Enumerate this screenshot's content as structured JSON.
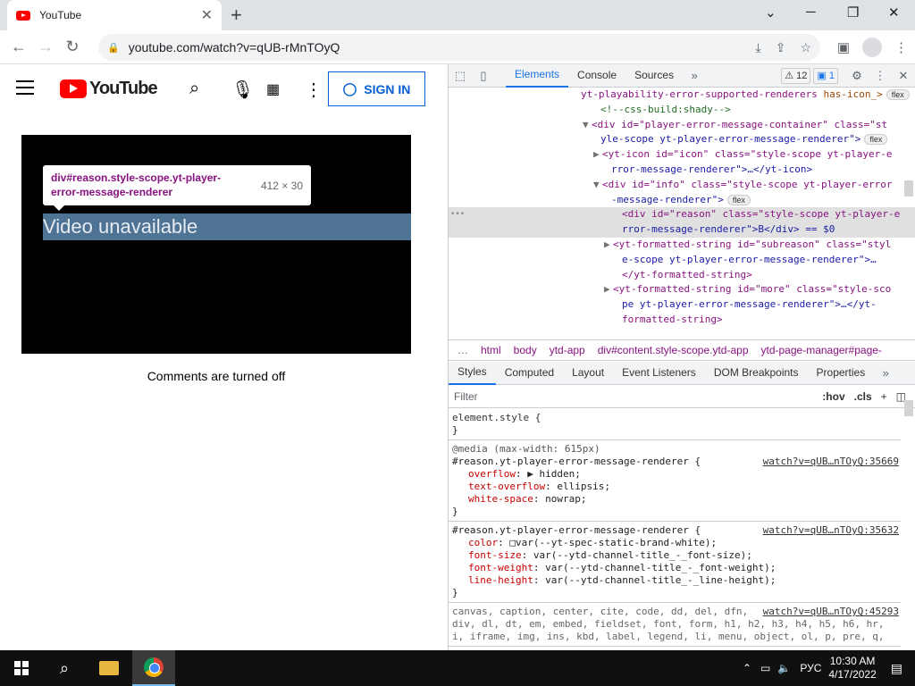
{
  "browser": {
    "tab_title": "YouTube",
    "url": "youtube.com/watch?v=qUB-rMnTOyQ"
  },
  "youtube": {
    "logo_text": "YouTube",
    "signin_label": "SIGN IN",
    "tooltip_name": "div#reason.style-scope.yt-player-error-message-renderer",
    "tooltip_size": "412 × 30",
    "reason_text": "Video unavailable",
    "comments_text": "Comments are turned off"
  },
  "devtools": {
    "tabs": [
      "Elements",
      "Console",
      "Sources"
    ],
    "warn_count": "12",
    "info_count": "1",
    "dom_lines": [
      {
        "indent": 148,
        "tri": "",
        "html": "yt-playability-error-supported-renderers",
        "type": "tg",
        "extra": " has-icon_>",
        "flex": true
      },
      {
        "indent": 170,
        "tri": "",
        "html": "<!--css-build:shady-->",
        "type": "cm"
      },
      {
        "indent": 160,
        "tri": "▼",
        "html": "<div id=\"player-error-message-container\" class=\"st",
        "type": "mix"
      },
      {
        "indent": 170,
        "tri": "",
        "html": "yle-scope yt-player-error-message-renderer\">",
        "type": "av",
        "flex": true
      },
      {
        "indent": 172,
        "tri": "▶",
        "html": "<yt-icon id=\"icon\" class=\"style-scope yt-player-e",
        "type": "mix"
      },
      {
        "indent": 182,
        "tri": "",
        "html": "rror-message-renderer\">…</yt-icon>",
        "type": "av"
      },
      {
        "indent": 172,
        "tri": "▼",
        "html": "<div id=\"info\" class=\"style-scope yt-player-error",
        "type": "mix"
      },
      {
        "indent": 182,
        "tri": "",
        "html": "-message-renderer\">",
        "type": "av",
        "flex": true
      },
      {
        "indent": 194,
        "tri": "",
        "html": "<div id=\"reason\" class=\"style-scope yt-player-e",
        "type": "mix",
        "sel": true
      },
      {
        "indent": 194,
        "tri": "",
        "html": "rror-message-renderer\">B</div> == $0",
        "type": "av",
        "sel": true
      },
      {
        "indent": 184,
        "tri": "▶",
        "html": "<yt-formatted-string id=\"subreason\" class=\"styl",
        "type": "mix"
      },
      {
        "indent": 194,
        "tri": "",
        "html": "e-scope yt-player-error-message-renderer\">…",
        "type": "av"
      },
      {
        "indent": 194,
        "tri": "",
        "html": "</yt-formatted-string>",
        "type": "tg"
      },
      {
        "indent": 184,
        "tri": "▶",
        "html": "<yt-formatted-string id=\"more\" class=\"style-sco",
        "type": "mix"
      },
      {
        "indent": 194,
        "tri": "",
        "html": "pe yt-player-error-message-renderer\">…</yt-",
        "type": "av"
      },
      {
        "indent": 194,
        "tri": "",
        "html": "formatted-string>",
        "type": "tg"
      }
    ],
    "breadcrumbs": [
      "…",
      "html",
      "body",
      "ytd-app",
      "div#content.style-scope.ytd-app",
      "ytd-page-manager#page-"
    ],
    "sub_tabs": [
      "Styles",
      "Computed",
      "Layout",
      "Event Listeners",
      "DOM Breakpoints",
      "Properties"
    ],
    "filter_placeholder": "Filter",
    "hov": ":hov",
    "cls": ".cls",
    "element_style": "element.style {",
    "rule1": {
      "media": "@media (max-width: 615px)",
      "selector": "#reason.yt-player-error-message-renderer {",
      "source": "watch?v=qUB…nTOyQ:35669",
      "props": [
        {
          "name": "overflow",
          "value": "▶ hidden;"
        },
        {
          "name": "text-overflow",
          "value": "ellipsis;"
        },
        {
          "name": "white-space",
          "value": "nowrap;"
        }
      ]
    },
    "rule2": {
      "selector": "#reason.yt-player-error-message-renderer {",
      "source": "watch?v=qUB…nTOyQ:35632",
      "props": [
        {
          "name": "color",
          "value": "□var(--yt-spec-static-brand-white);"
        },
        {
          "name": "font-size",
          "value": "var(--ytd-channel-title_-_font-size);"
        },
        {
          "name": "font-weight",
          "value": "var(--ytd-channel-title_-_font-weight);"
        },
        {
          "name": "line-height",
          "value": "var(--ytd-channel-title_-_line-height);"
        }
      ]
    },
    "rule3": {
      "source": "watch?v=qUB…nTOyQ:45293",
      "lines": [
        "canvas, caption, center, cite, code, dd, del, dfn,",
        "div, dl, dt, em, embed, fieldset, font, form, h1, h2, h3, h4, h5, h6, hr,",
        "i, iframe, img, ins, kbd, label, legend, li, menu, object, ol, p, pre, q,"
      ]
    }
  },
  "taskbar": {
    "lang": "РУС",
    "time": "10:30 AM",
    "date": "4/17/2022"
  }
}
